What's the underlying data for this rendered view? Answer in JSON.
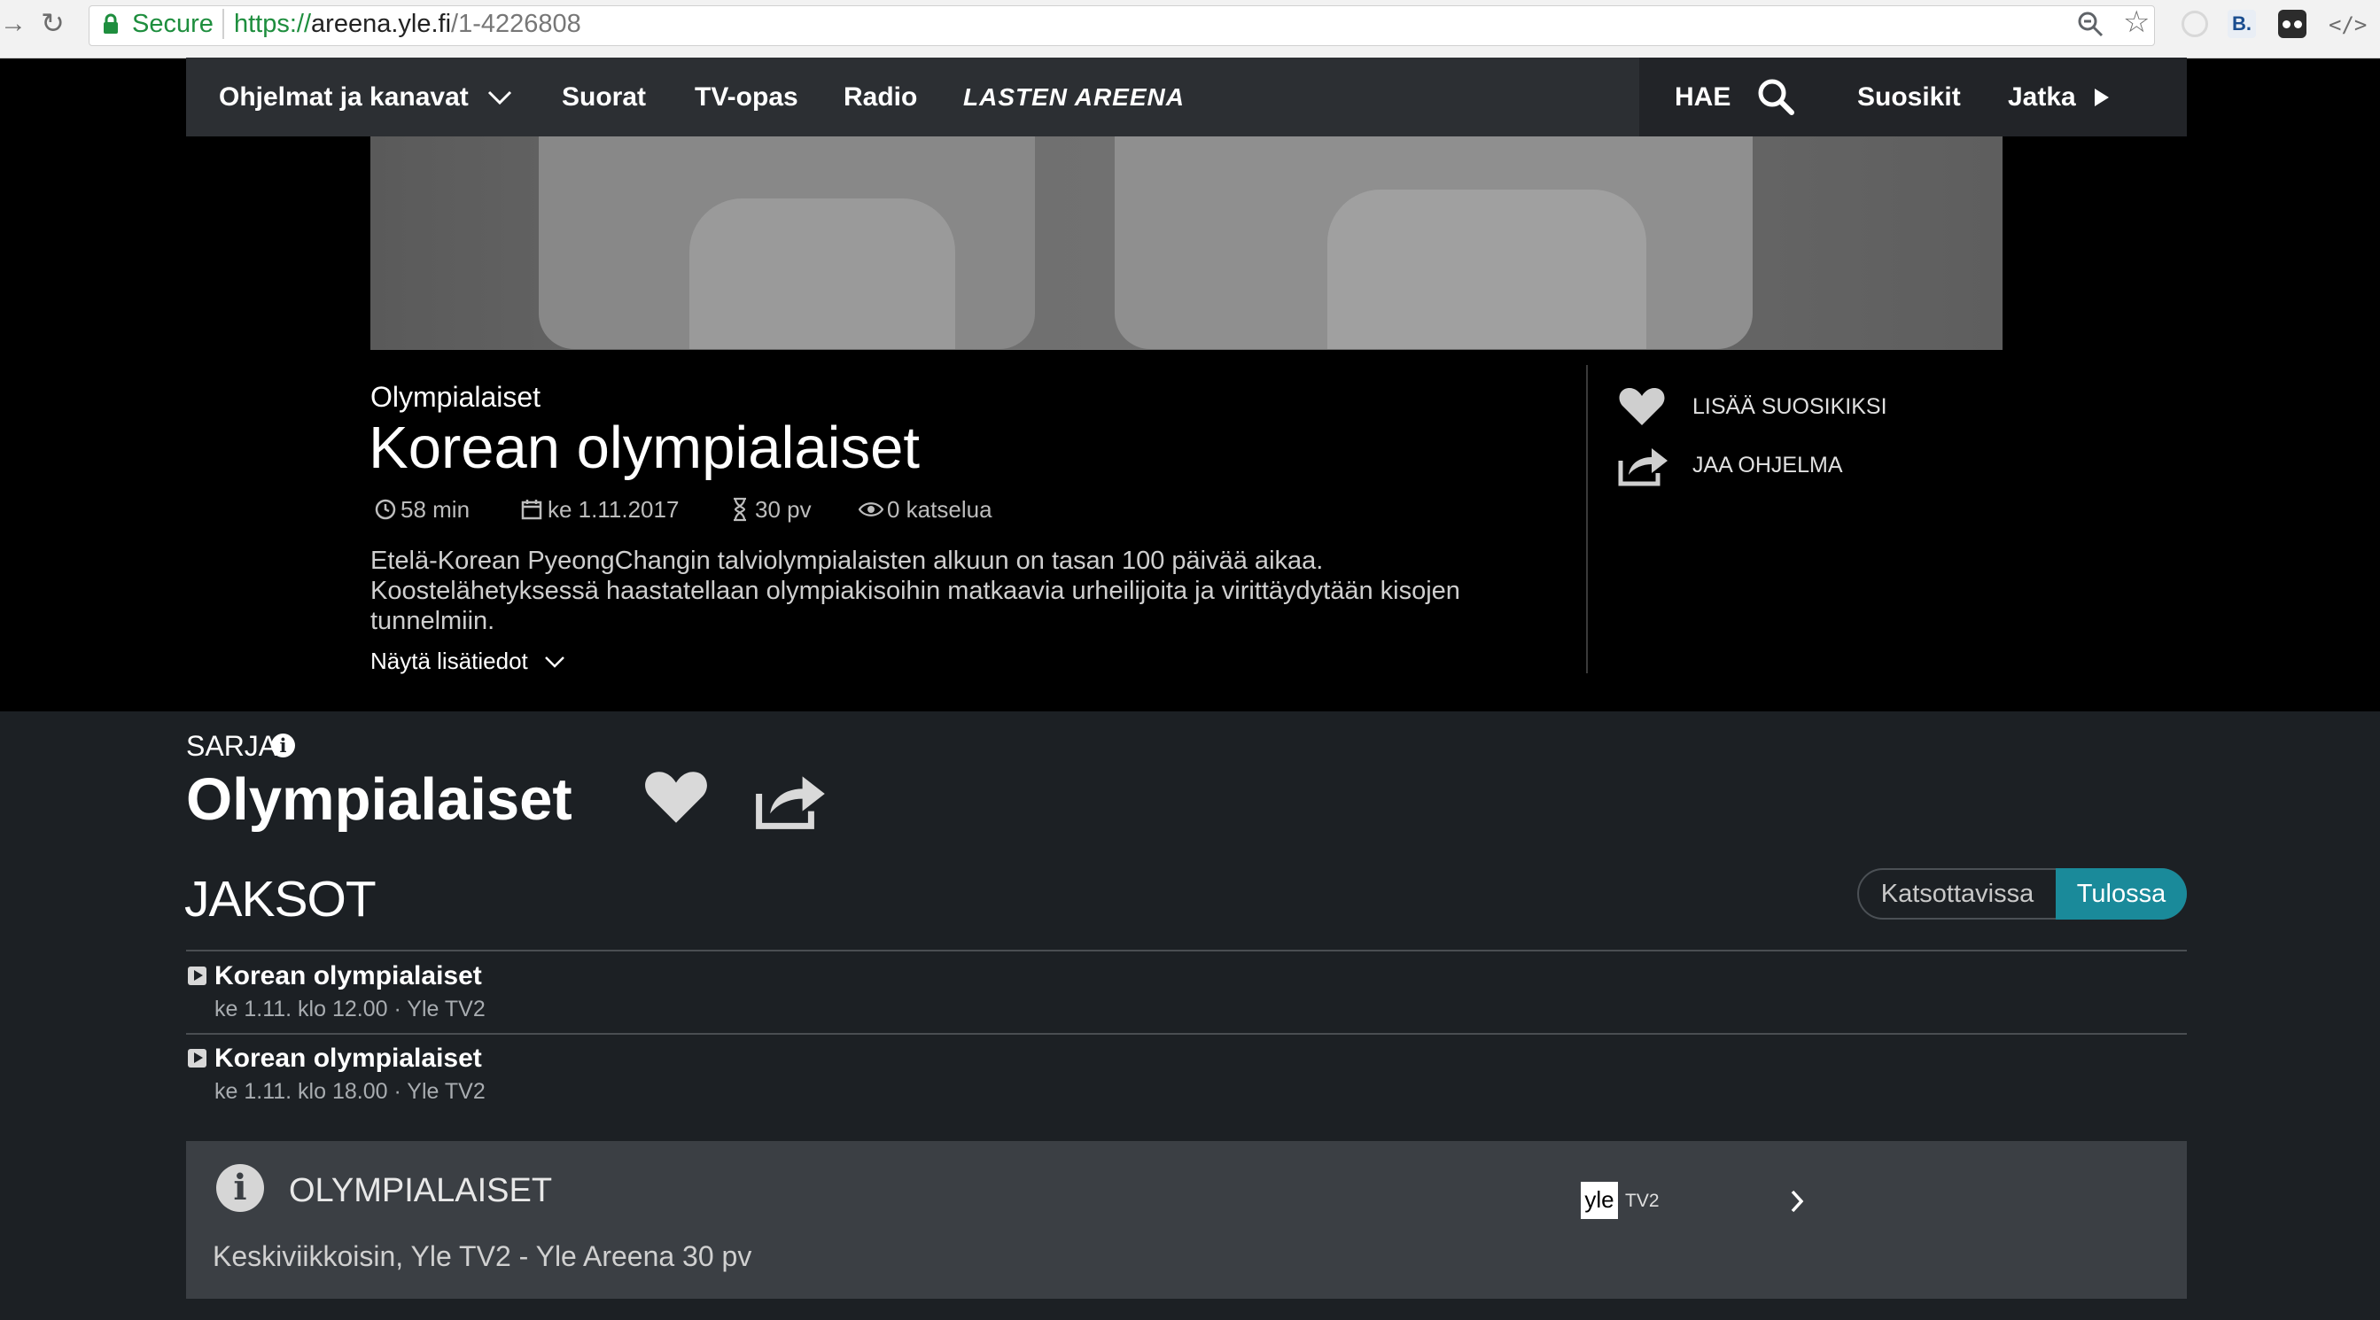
{
  "browser": {
    "secure_label": "Secure",
    "url_scheme": "https://",
    "url_host": "areena.yle.fi",
    "url_path": "/1-4226808"
  },
  "nav": {
    "programs": "Ohjelmat ja kanavat",
    "live": "Suorat",
    "tv_guide": "TV-opas",
    "radio": "Radio",
    "kids": "LASTEN AREENA",
    "search": "HAE",
    "favorites": "Suosikit",
    "continue": "Jatka"
  },
  "program": {
    "series_name": "Olympialaiset",
    "title": "Korean olympialaiset",
    "duration": "58 min",
    "date": "ke 1.11.2017",
    "availability": "30 pv",
    "views": "0 katselua",
    "description_lines": [
      "Etelä-Korean PyeongChangin talviolympialaisten alkuun on tasan 100 päivää aikaa.",
      "Koostelähetyksessä haastatellaan olympiakisoihin matkaavia urheilijoita ja virittäydytään kisojen",
      "tunnelmiin."
    ],
    "more_info": "Näytä lisätiedot",
    "add_favorite": "LISÄÄ SUOSIKIKSI",
    "share": "JAA OHJELMA"
  },
  "series": {
    "label": "SARJA",
    "title": "Olympialaiset",
    "episodes_heading": "JAKSOT",
    "tab_available": "Katsottavissa",
    "tab_upcoming": "Tulossa",
    "active_tab": "Tulossa",
    "episodes": [
      {
        "title": "Korean olympialaiset",
        "info": "ke 1.11. klo 12.00 · Yle TV2"
      },
      {
        "title": "Korean olympialaiset",
        "info": "ke 1.11. klo 18.00 · Yle TV2"
      }
    ]
  },
  "info_box": {
    "title": "OLYMPIALAISET",
    "schedule": "Keskiviikkoisin, Yle TV2 - Yle Areena 30 pv",
    "channel_logo": "yle",
    "channel_name": "TV2"
  },
  "colors": {
    "accent_teal": "#1a8a9a",
    "secure_green": "#1e8e3e",
    "nav_bg": "#2c2f33",
    "series_bg": "#1c2024"
  }
}
